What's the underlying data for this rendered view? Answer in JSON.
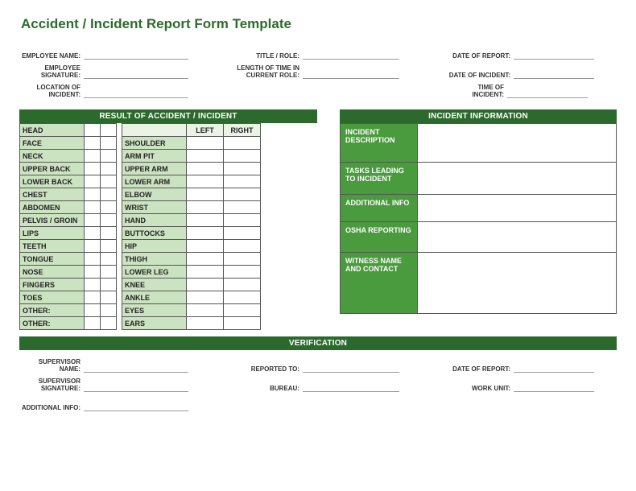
{
  "title": "Accident / Incident Report Form Template",
  "header": {
    "row1": {
      "employee_name": "EMPLOYEE NAME:",
      "title_role": "TITLE / ROLE:",
      "date_of_report": "DATE OF REPORT:"
    },
    "row2": {
      "employee_signature": "EMPLOYEE SIGNATURE:",
      "length": "LENGTH OF TIME IN CURRENT ROLE:",
      "date_of_incident": "DATE OF INCIDENT:"
    },
    "row3": {
      "location": "LOCATION OF INCIDENT:",
      "time": "TIME OF INCIDENT:"
    }
  },
  "result": {
    "bar": "RESULT OF ACCIDENT / INCIDENT",
    "left": "LEFT",
    "right": "RIGHT",
    "colA": [
      "HEAD",
      "FACE",
      "NECK",
      "UPPER BACK",
      "LOWER BACK",
      "CHEST",
      "ABDOMEN",
      "PELVIS / GROIN",
      "LIPS",
      "TEETH",
      "TONGUE",
      "NOSE",
      "FINGERS",
      "TOES",
      "OTHER:",
      "OTHER:"
    ],
    "colB": [
      "SHOULDER",
      "ARM PIT",
      "UPPER ARM",
      "LOWER ARM",
      "ELBOW",
      "WRIST",
      "HAND",
      "BUTTOCKS",
      "HIP",
      "THIGH",
      "LOWER LEG",
      "KNEE",
      "ANKLE",
      "EYES",
      "EARS"
    ]
  },
  "info": {
    "bar": "INCIDENT INFORMATION",
    "labels": [
      "INCIDENT DESCRIPTION",
      "TASKS LEADING TO INCIDENT",
      "ADDITIONAL INFO",
      "OSHA REPORTING",
      "WITNESS NAME AND CONTACT"
    ]
  },
  "verification": {
    "bar": "VERIFICATION",
    "row1": {
      "supervisor_name": "SUPERVISOR NAME:",
      "reported_to": "REPORTED TO:",
      "date_of_report": "DATE OF REPORT:"
    },
    "row2": {
      "supervisor_signature": "SUPERVISOR SIGNATURE:",
      "bureau": "BUREAU:",
      "work_unit": "WORK UNIT:"
    },
    "row3": {
      "additional_info": "ADDITIONAL INFO:"
    }
  }
}
